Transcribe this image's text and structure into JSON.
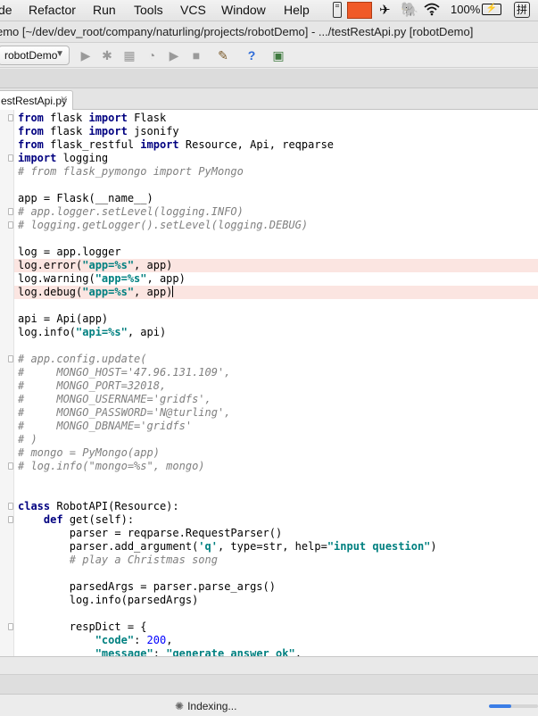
{
  "menubar": {
    "items": [
      "de",
      "Refactor",
      "Run",
      "Tools",
      "VCS",
      "Window",
      "Help"
    ],
    "battery": "100%"
  },
  "window": {
    "title": "emo [~/dev/dev_root/company/naturling/projects/robotDemo] - .../testRestApi.py [robotDemo]"
  },
  "toolbar": {
    "run_config": "robotDemo"
  },
  "tabs": [
    {
      "label": "estRestApi.py",
      "active": true
    }
  ],
  "editor": {
    "lines": [
      "<span class=\"kw\">from</span> flask <span class=\"kw\">import</span> Flask",
      "<span class=\"kw\">from</span> flask <span class=\"kw\">import</span> jsonify",
      "<span class=\"kw\">from</span> flask_restful <span class=\"kw\">import</span> Resource, Api, reqparse",
      "<span class=\"kw\">import</span> logging",
      "<span class=\"cm\"># from flask_pymongo import PyMongo</span>",
      "",
      "app = Flask(__name__)",
      "<span class=\"cm\"># app.logger.setLevel(logging.INFO)</span>",
      "<span class=\"cm\"># logging.getLogger().setLevel(logging.DEBUG)</span>",
      "",
      "log = app.logger",
      "log.error(<span class=\"st\">\"app=%s\"</span>, app)",
      "log.warning(<span class=\"st\">\"app=%s\"</span>, app)",
      "log.debug(<span class=\"st\">\"app=%s\"</span>, app)",
      "",
      "api = Api(app)",
      "log.info(<span class=\"st\">\"api=%s\"</span>, api)",
      "",
      "<span class=\"cm\"># app.config.update(</span>",
      "<span class=\"cm\">#     MONGO_HOST='47.96.131.109',</span>",
      "<span class=\"cm\">#     MONGO_PORT=32018,</span>",
      "<span class=\"cm\">#     MONGO_USERNAME='gridfs',</span>",
      "<span class=\"cm\">#     MONGO_PASSWORD='N@turling',</span>",
      "<span class=\"cm\">#     MONGO_DBNAME='gridfs'</span>",
      "<span class=\"cm\"># )</span>",
      "<span class=\"cm\"># mongo = PyMongo(app)</span>",
      "<span class=\"cm\"># log.info(\"mongo=%s\", mongo)</span>",
      "",
      "",
      "<span class=\"kw\">class</span> RobotAPI(Resource):",
      "    <span class=\"kw\">def</span> get(self):",
      "        parser = reqparse.RequestParser()",
      "        parser.add_argument(<span class=\"st\">'q'</span>, type=str, help=<span class=\"st\">\"input question\"</span>)",
      "        <span class=\"cm\"># play a Christmas song</span>",
      "",
      "        parsedArgs = parser.parse_args()",
      "        log.info(parsedArgs)",
      "",
      "        respDict = {",
      "            <span class=\"st\">\"code\"</span>: <span class=\"nm\">200</span>,",
      "            <span class=\"st\">\"message\"</span>: <span class=\"st\">\"generate answer ok\"</span>,"
    ],
    "highlighted_lines": [
      11,
      13
    ],
    "caret_line": 13
  },
  "status": {
    "indexing_label": "Indexing...",
    "progress_fraction": 0.45
  }
}
